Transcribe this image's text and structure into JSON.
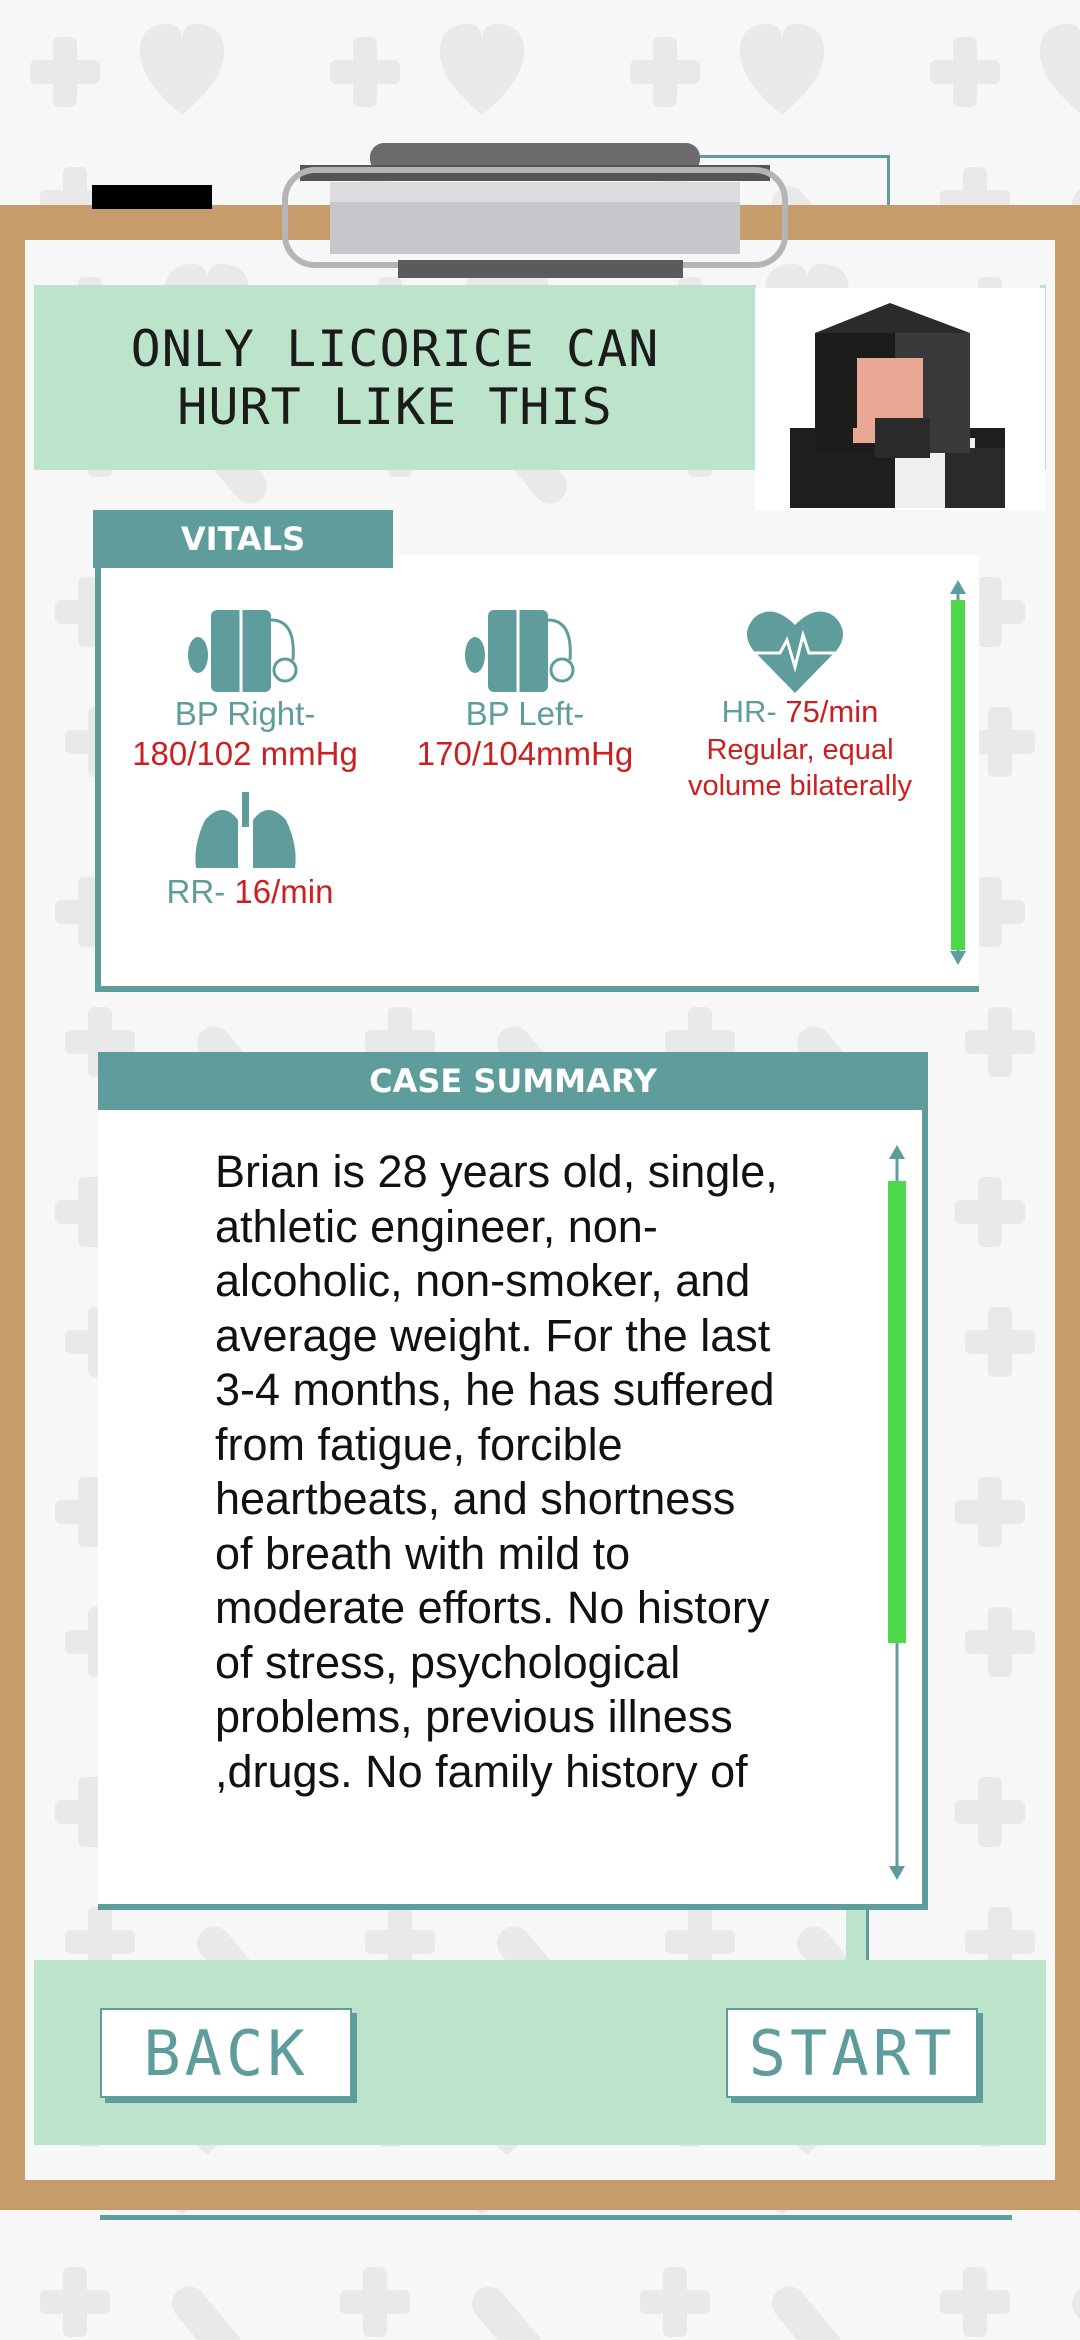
{
  "header": {
    "title_line1": "ONLY LICORICE CAN",
    "title_line2": "HURT LIKE THIS"
  },
  "vitals": {
    "tab_label": "VITALS",
    "bp_right": {
      "label": "BP Right-",
      "value": "180/102 mmHg"
    },
    "bp_left": {
      "label": "BP Left-",
      "value": "170/104mmHg"
    },
    "hr": {
      "label": "HR- ",
      "value": "75/min",
      "note_line1": "Regular, equal",
      "note_line2": "volume bilaterally"
    },
    "rr": {
      "label": "RR- ",
      "value": "16/min"
    }
  },
  "summary": {
    "tab_label": "CASE SUMMARY",
    "text": "Brian is 28 years old, single, athletic engineer, non-alcoholic, non-smoker, and average weight. For the last 3-4 months, he has suffered from fatigue, forcible heartbeats, and shortness of breath with mild to moderate efforts. No history of stress, psychological problems, previous illness ,drugs. No family history of"
  },
  "buttons": {
    "back": "BACK",
    "start": "START"
  },
  "colors": {
    "teal": "#5f9c9c",
    "mint": "#bce4cb",
    "board": "#c89c6a",
    "value_red": "#cc1f1f",
    "scroll_green": "#4fd84a"
  },
  "icons": [
    "blood-pressure-icon",
    "heart-rate-icon",
    "lungs-icon",
    "scroll-up-arrow-icon",
    "scroll-down-arrow-icon"
  ]
}
